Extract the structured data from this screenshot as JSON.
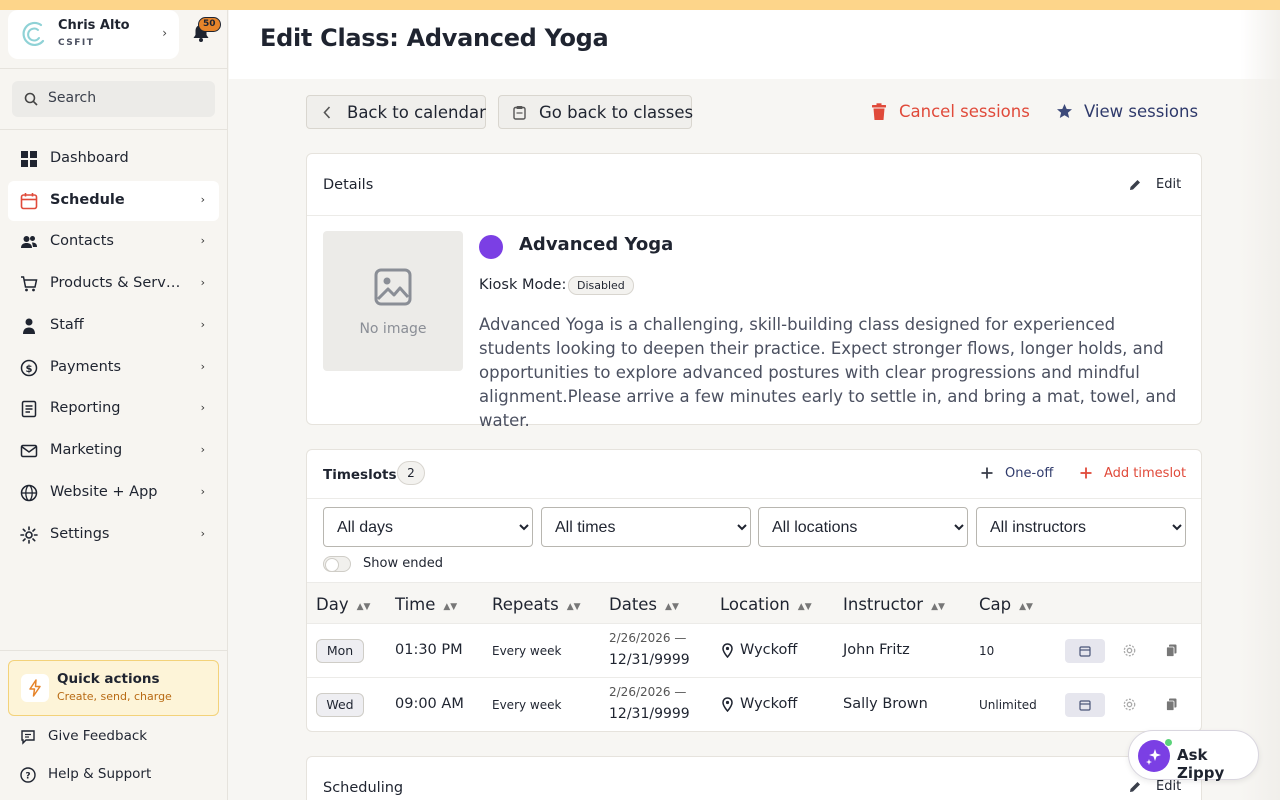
{
  "account": {
    "name": "Chris Alto",
    "org": "CSFIT",
    "notifications": "50"
  },
  "search": {
    "placeholder": "Search"
  },
  "sidebar": {
    "items": [
      {
        "label": "Dashboard",
        "icon": "dashboard-icon"
      },
      {
        "label": "Schedule",
        "icon": "calendar-icon"
      },
      {
        "label": "Contacts",
        "icon": "contacts-icon"
      },
      {
        "label": "Products & Services",
        "icon": "cart-icon"
      },
      {
        "label": "Staff",
        "icon": "person-icon"
      },
      {
        "label": "Payments",
        "icon": "dollar-icon"
      },
      {
        "label": "Reporting",
        "icon": "report-icon"
      },
      {
        "label": "Marketing",
        "icon": "mail-icon"
      },
      {
        "label": "Website + App",
        "icon": "globe-icon"
      },
      {
        "label": "Settings",
        "icon": "gear-icon"
      }
    ],
    "quick_actions": {
      "title": "Quick actions",
      "subtitle": "Create, send, charge"
    },
    "feedback": "Give Feedback",
    "help": "Help & Support"
  },
  "page": {
    "title": "Edit Class: Advanced Yoga"
  },
  "toolbar": {
    "back_calendar": "Back to calendar",
    "back_classes": "Go back to classes",
    "cancel_sessions": "Cancel sessions",
    "view_sessions": "View sessions"
  },
  "details": {
    "heading": "Details",
    "edit": "Edit",
    "no_image": "No image",
    "class_name": "Advanced Yoga",
    "class_color": "#7b3fe4",
    "kiosk_label": "Kiosk Mode:",
    "kiosk_value": "Disabled",
    "description": "Advanced Yoga is a challenging, skill-building class designed for experienced students looking to deepen their practice. Expect stronger flows, longer holds, and opportunities to explore advanced postures with clear progressions and mindful alignment.Please arrive a few minutes early to settle in, and bring a mat, towel, and water."
  },
  "timeslots": {
    "heading": "Timeslots",
    "count": "2",
    "one_off": "One-off",
    "add": "Add timeslot",
    "filters": {
      "days": "All days",
      "times": "All times",
      "locations": "All locations",
      "instructors": "All instructors"
    },
    "show_ended": "Show ended",
    "columns": [
      "Day",
      "Time",
      "Repeats",
      "Dates",
      "Location",
      "Instructor",
      "Cap"
    ],
    "rows": [
      {
        "day": "Mon",
        "time": "01:30 PM",
        "repeats": "Every week",
        "date_start": "2/26/2026 —",
        "date_end": "12/31/9999",
        "location": "Wyckoff",
        "instructor": "John Fritz",
        "cap": "10"
      },
      {
        "day": "Wed",
        "time": "09:00 AM",
        "repeats": "Every week",
        "date_start": "2/26/2026 —",
        "date_end": "12/31/9999",
        "location": "Wyckoff",
        "instructor": "Sally Brown",
        "cap": "Unlimited"
      }
    ]
  },
  "scheduling": {
    "heading": "Scheduling",
    "edit": "Edit"
  },
  "assistant": {
    "label": "Ask Zippy"
  },
  "colors": {
    "accent_red": "#e04a3a",
    "accent_purple": "#7b3fe4",
    "quick_border": "#f3d27a",
    "top_strip": "#fdd58a"
  }
}
